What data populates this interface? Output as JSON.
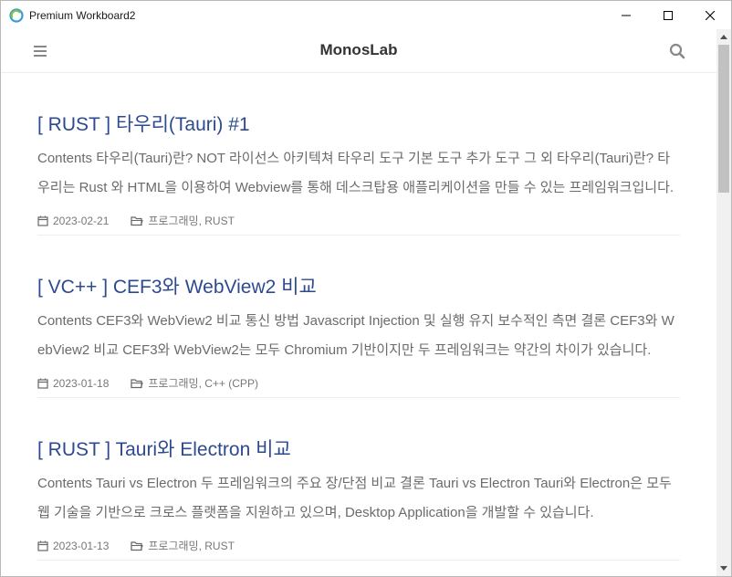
{
  "window": {
    "title": "Premium Workboard2"
  },
  "header": {
    "brand": "MonosLab"
  },
  "posts": [
    {
      "title": "[ RUST ] 타우리(Tauri) #1",
      "excerpt": "Contents 타우리(Tauri)란? NOT 라이선스 아키텍쳐 타우리 도구 기본 도구 추가 도구 그 외 타우리(Tauri)란? 타우리는 Rust 와 HTML을 이용하여 Webview를 통해 데스크탑용 애플리케이션을 만들 수 있는 프레임워크입니다.",
      "date": "2023-02-21",
      "category": "프로그래밍, RUST"
    },
    {
      "title": "[ VC++ ] CEF3와 WebView2 비교",
      "excerpt": "Contents CEF3와 WebView2 비교 통신 방법 Javascript Injection 및 실행 유지 보수적인 측면 결론 CEF3와 WebView2 비교 CEF3와 WebView2는 모두 Chromium 기반이지만 두 프레임워크는 약간의 차이가 있습니다.",
      "date": "2023-01-18",
      "category": "프로그래밍, C++ (CPP)"
    },
    {
      "title": "[ RUST ] Tauri와 Electron 비교",
      "excerpt": "Contents Tauri vs Electron 두 프레임워크의 주요 장/단점 비교 결론 Tauri vs Electron Tauri와 Electron은 모두 웹 기술을 기반으로 크로스 플랫폼을 지원하고 있으며, Desktop Application을 개발할 수 있습니다.",
      "date": "2023-01-13",
      "category": "프로그래밍, RUST"
    }
  ],
  "colors": {
    "title_link": "#2e4a8f",
    "excerpt_text": "#6b6b6b",
    "meta_text": "#777777"
  },
  "icons": {
    "app": "edge-webview-icon",
    "menu": "hamburger-menu-icon",
    "search": "search-icon",
    "date": "calendar-icon",
    "category": "folder-icon"
  }
}
